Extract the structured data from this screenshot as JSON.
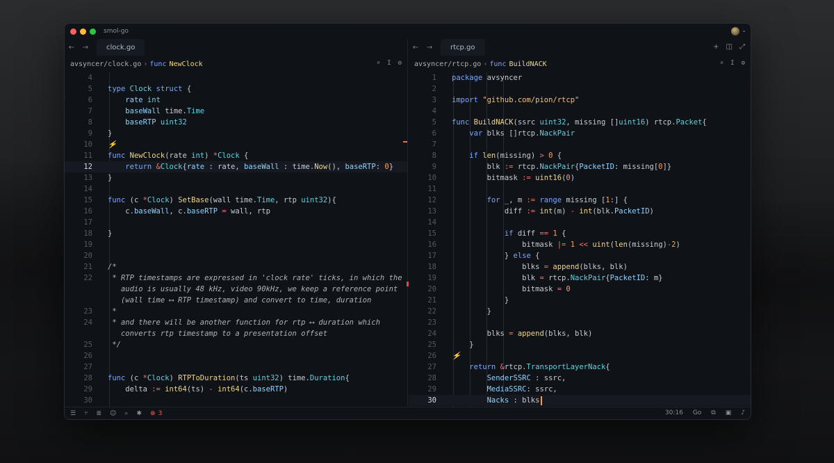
{
  "window": {
    "title": "smol-go"
  },
  "left": {
    "tab": "clock.go",
    "crumb": {
      "path": "avsyncer/clock.go",
      "sep": "›",
      "kw": "func",
      "fn": "NewClock"
    },
    "lines": [
      {
        "n": "4",
        "html": ""
      },
      {
        "n": "5",
        "html": "<span class='k'>type</span> <span class='t'>Clock</span> <span class='k'>struct</span> {"
      },
      {
        "n": "6",
        "html": "    <span class='fld'>rate</span> <span class='t'>int</span>"
      },
      {
        "n": "7",
        "html": "    <span class='fld'>baseWall</span> time.<span class='t'>Time</span>"
      },
      {
        "n": "8",
        "html": "    <span class='fld'>baseRTP</span> <span class='t'>uint32</span>"
      },
      {
        "n": "9",
        "html": "}"
      },
      {
        "n": "10",
        "html": "<span class='c'>⚡</span>"
      },
      {
        "n": "11",
        "html": "<span class='k'>func</span> <span class='f'>NewClock</span>(rate <span class='t'>int</span>) <span class='op'>*</span><span class='t'>Clock</span> {"
      },
      {
        "n": "12",
        "html": "    <span class='k'>return</span> <span class='op'>&amp;</span><span class='t'>Clock</span>{<span class='fld'>rate</span> : rate, <span class='fld'>baseWall</span> : time.<span class='f'>Now</span>(), <span class='fld'>baseRTP</span>: <span class='n'>0</span>}",
        "active": true
      },
      {
        "n": "13",
        "html": "}"
      },
      {
        "n": "14",
        "html": ""
      },
      {
        "n": "15",
        "html": "<span class='k'>func</span> (c <span class='op'>*</span><span class='t'>Clock</span>) <span class='f'>SetBase</span>(wall time.<span class='t'>Time</span>, rtp <span class='t'>uint32</span>){"
      },
      {
        "n": "16",
        "html": "    c.<span class='fld'>baseWall</span>, c.<span class='fld'>baseRTP</span> <span class='op'>=</span> wall, rtp"
      },
      {
        "n": "17",
        "html": ""
      },
      {
        "n": "18",
        "html": "}"
      },
      {
        "n": "19",
        "html": ""
      },
      {
        "n": "20",
        "html": ""
      },
      {
        "n": "21",
        "html": "<span class='c'>/*</span>"
      },
      {
        "n": "22",
        "html": "<span class='c'> * RTP timestamps are expressed in 'clock rate' ticks, in which the</span>"
      },
      {
        "n": "",
        "html": "<span class='c'>   audio is usually 48 kHz, video 90kHz, we keep a reference point</span>"
      },
      {
        "n": "",
        "html": "<span class='c'>   (wall time ⟷ RTP timestamp) and convert to time, duration</span>"
      },
      {
        "n": "23",
        "html": "<span class='c'> *</span>"
      },
      {
        "n": "24",
        "html": "<span class='c'> * and there will be another function for rtp ⟷ duration which</span>"
      },
      {
        "n": "",
        "html": "<span class='c'>   converts rtp timestamp to a presentation offset</span>"
      },
      {
        "n": "25",
        "html": "<span class='c'> */</span>"
      },
      {
        "n": "26",
        "html": ""
      },
      {
        "n": "27",
        "html": ""
      },
      {
        "n": "28",
        "html": "<span class='k'>func</span> (c <span class='op'>*</span><span class='t'>Clock</span>) <span class='f'>RTPToDuration</span>(ts <span class='t'>uint32</span>) time.<span class='t'>Duration</span>{"
      },
      {
        "n": "29",
        "html": "    delta <span class='op'>:=</span> <span class='f'>int64</span>(ts) <span class='op'>-</span> <span class='f'>int64</span>(c.<span class='fld'>baseRTP</span>)"
      },
      {
        "n": "30",
        "html": ""
      }
    ]
  },
  "right": {
    "tab": "rtcp.go",
    "crumb": {
      "path": "avsyncer/rtcp.go",
      "sep": "›",
      "kw": "func",
      "fn": "BuildNACK"
    },
    "lines": [
      {
        "n": "1",
        "html": "<span class='k'>package</span> avsyncer"
      },
      {
        "n": "2",
        "html": ""
      },
      {
        "n": "3",
        "html": "<span class='k'>import</span> <span class='s'>\"github.com/pion/rtcp\"</span>"
      },
      {
        "n": "4",
        "html": ""
      },
      {
        "n": "5",
        "html": "<span class='k'>func</span> <span class='f'>BuildNACK</span>(ssrc <span class='t'>uint32</span>, missing []<span class='t'>uint16</span>) rtcp.<span class='t'>Packet</span>{"
      },
      {
        "n": "6",
        "html": "    <span class='k'>var</span> blks []rtcp.<span class='t'>NackPair</span>"
      },
      {
        "n": "7",
        "html": ""
      },
      {
        "n": "8",
        "html": "    <span class='k'>if</span> <span class='f'>len</span>(missing) <span class='op'>&gt;</span> <span class='n'>0</span> {"
      },
      {
        "n": "9",
        "html": "        blk <span class='op'>:=</span> rtcp.<span class='t'>NackPair</span>{<span class='fld'>PacketID</span>: missing[<span class='n'>0</span>]}"
      },
      {
        "n": "10",
        "html": "        bitmask <span class='op'>:=</span> <span class='f'>uint16</span>(<span class='n'>0</span>)"
      },
      {
        "n": "11",
        "html": ""
      },
      {
        "n": "12",
        "html": "        <span class='k'>for</span> _, m <span class='op'>:=</span> <span class='k'>range</span> missing [<span class='n'>1</span>:] {"
      },
      {
        "n": "13",
        "html": "            diff <span class='op'>:=</span> <span class='f'>int</span>(m) <span class='op'>-</span> <span class='f'>int</span>(blk.<span class='fld'>PacketID</span>)"
      },
      {
        "n": "14",
        "html": ""
      },
      {
        "n": "15",
        "html": "            <span class='k'>if</span> diff <span class='op'>==</span> <span class='n'>1</span> {"
      },
      {
        "n": "16",
        "html": "                bitmask <span class='op'>|=</span> <span class='n'>1</span> <span class='op'>&lt;&lt;</span> <span class='f'>uint</span>(<span class='f'>len</span>(missing)<span class='op'>-</span><span class='n'>2</span>)"
      },
      {
        "n": "17",
        "html": "            } <span class='k'>else</span> {"
      },
      {
        "n": "18",
        "html": "                blks <span class='op'>=</span> <span class='f'>append</span>(blks, blk)"
      },
      {
        "n": "19",
        "html": "                blk <span class='op'>=</span> rtcp.<span class='t'>NackPair</span>{<span class='fld'>PacketID</span>: m}"
      },
      {
        "n": "20",
        "html": "                bitmask <span class='op'>=</span> <span class='n'>0</span>"
      },
      {
        "n": "21",
        "html": "            }"
      },
      {
        "n": "22",
        "html": "        }"
      },
      {
        "n": "23",
        "html": ""
      },
      {
        "n": "24",
        "html": "        blks <span class='op'>=</span> <span class='f'>append</span>(blks, blk)"
      },
      {
        "n": "25",
        "html": "    }"
      },
      {
        "n": "26",
        "html": "<span class='c'>⚡</span>"
      },
      {
        "n": "27",
        "html": "    <span class='k'>return</span> <span class='op'>&amp;</span>rtcp.<span class='t'>TransportLayerNack</span>{"
      },
      {
        "n": "28",
        "html": "        <span class='fld'>SenderSSRC</span> : ssrc,"
      },
      {
        "n": "29",
        "html": "        <span class='fld'>MediaSSRC</span>: ssrc,"
      },
      {
        "n": "30",
        "html": "        <span class='fld'>Nacks</span> : blks<span class='cursor'></span>",
        "active": true
      }
    ]
  },
  "status": {
    "errors": "3",
    "position": "30:16",
    "language": "Go"
  },
  "colors": {
    "accent": "#ff9a3c",
    "error": "#ff5c57"
  }
}
